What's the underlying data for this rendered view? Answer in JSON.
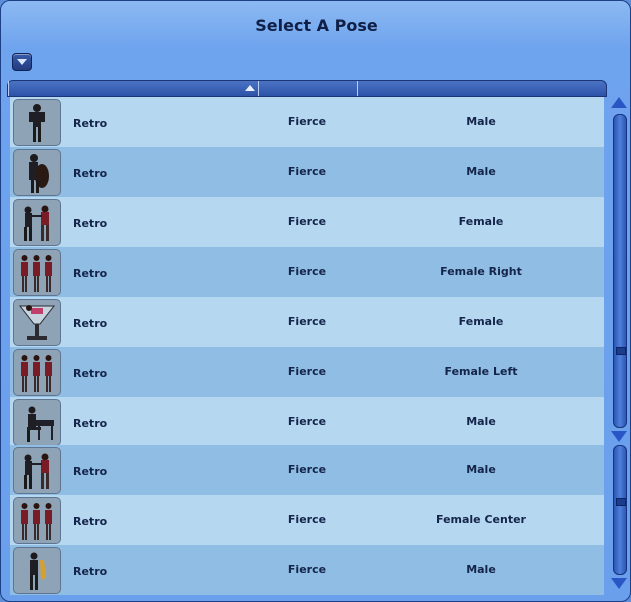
{
  "window": {
    "title": "Select A Pose"
  },
  "colors": {
    "frame": "#6a9fec",
    "row_light": "#b5d7ef",
    "row_dark": "#90bde3",
    "text": "#14244a"
  },
  "rows": [
    {
      "icon": "pose-thumbnail-man-standing",
      "style": "Retro",
      "mood": "Fierce",
      "gender": "Male"
    },
    {
      "icon": "pose-thumbnail-man-cello",
      "style": "Retro",
      "mood": "Fierce",
      "gender": "Male"
    },
    {
      "icon": "pose-thumbnail-dancing-couple",
      "style": "Retro",
      "mood": "Fierce",
      "gender": "Female"
    },
    {
      "icon": "pose-thumbnail-three-dancers",
      "style": "Retro",
      "mood": "Fierce",
      "gender": "Female Right"
    },
    {
      "icon": "pose-thumbnail-woman-in-glass",
      "style": "Retro",
      "mood": "Fierce",
      "gender": "Female"
    },
    {
      "icon": "pose-thumbnail-three-dancers",
      "style": "Retro",
      "mood": "Fierce",
      "gender": "Female Left"
    },
    {
      "icon": "pose-thumbnail-man-piano",
      "style": "Retro",
      "mood": "Fierce",
      "gender": "Male"
    },
    {
      "icon": "pose-thumbnail-dancing-couple",
      "style": "Retro",
      "mood": "Fierce",
      "gender": "Male"
    },
    {
      "icon": "pose-thumbnail-three-dancers",
      "style": "Retro",
      "mood": "Fierce",
      "gender": "Female Center"
    },
    {
      "icon": "pose-thumbnail-man-saxophone",
      "style": "Retro",
      "mood": "Fierce",
      "gender": "Male"
    }
  ]
}
